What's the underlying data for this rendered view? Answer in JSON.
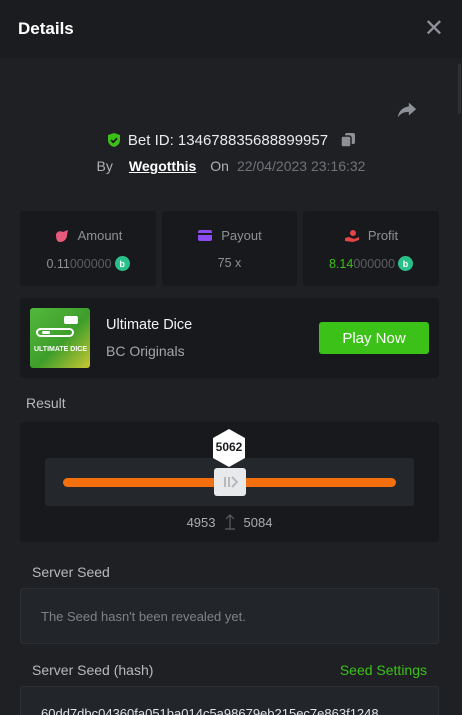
{
  "header": {
    "title": "Details",
    "close_icon": "close-icon"
  },
  "bet": {
    "id_label": "Bet ID: 134678835688899957",
    "by_label": "By",
    "user": "Wegotthis",
    "on_label": "On",
    "date": "22/04/2023 23:16:32"
  },
  "stats": {
    "amount": {
      "label": "Amount",
      "value_main": "0.11",
      "value_dim": "000000",
      "icon": "money-bag-icon",
      "icon_color": "#e85a7b"
    },
    "payout": {
      "label": "Payout",
      "value": "75 x",
      "icon": "wallet-icon",
      "icon_color": "#8a4cf0"
    },
    "profit": {
      "label": "Profit",
      "value_main": "8.14",
      "value_dim": "000000",
      "icon": "hand-coin-icon",
      "icon_color": "#e64545"
    }
  },
  "coin_glyph": "b",
  "game": {
    "name": "Ultimate Dice",
    "provider": "BC Originals",
    "play_label": "Play Now",
    "thumb_label": "ULTIMATE DICE"
  },
  "result": {
    "label": "Result",
    "value": "5062",
    "range_low": "4953",
    "range_high": "5084",
    "position_fraction": 0.506
  },
  "seeds": {
    "server_seed_label": "Server Seed",
    "server_seed_msg": "The Seed hasn't been revealed yet.",
    "hash_label": "Server Seed (hash)",
    "settings_label": "Seed Settings",
    "hash_value": "60dd7dbc04360fa051ba014c5a98679eb215ec7e863f1248"
  },
  "colors": {
    "accent_green": "#3bc117",
    "track_orange": "#f4700e",
    "coin_teal": "#2ac08a",
    "background": "#1e2024"
  }
}
